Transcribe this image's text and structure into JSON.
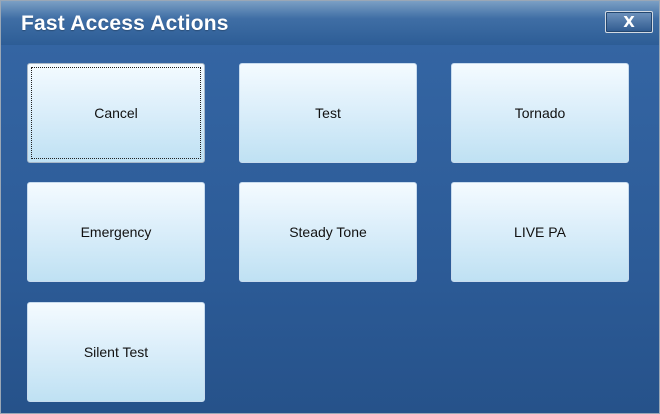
{
  "window": {
    "title": "Fast Access Actions",
    "close_label": "X"
  },
  "actions": [
    {
      "label": "Cancel"
    },
    {
      "label": "Test"
    },
    {
      "label": "Tornado"
    },
    {
      "label": "Emergency"
    },
    {
      "label": "Steady Tone"
    },
    {
      "label": "LIVE PA"
    },
    {
      "label": "Silent Test"
    }
  ],
  "colors": {
    "titlebar": "#3f6ea5",
    "background": "#2c5b97",
    "button_face": "#dff0fb"
  },
  "icons": {
    "close": "close-icon"
  }
}
